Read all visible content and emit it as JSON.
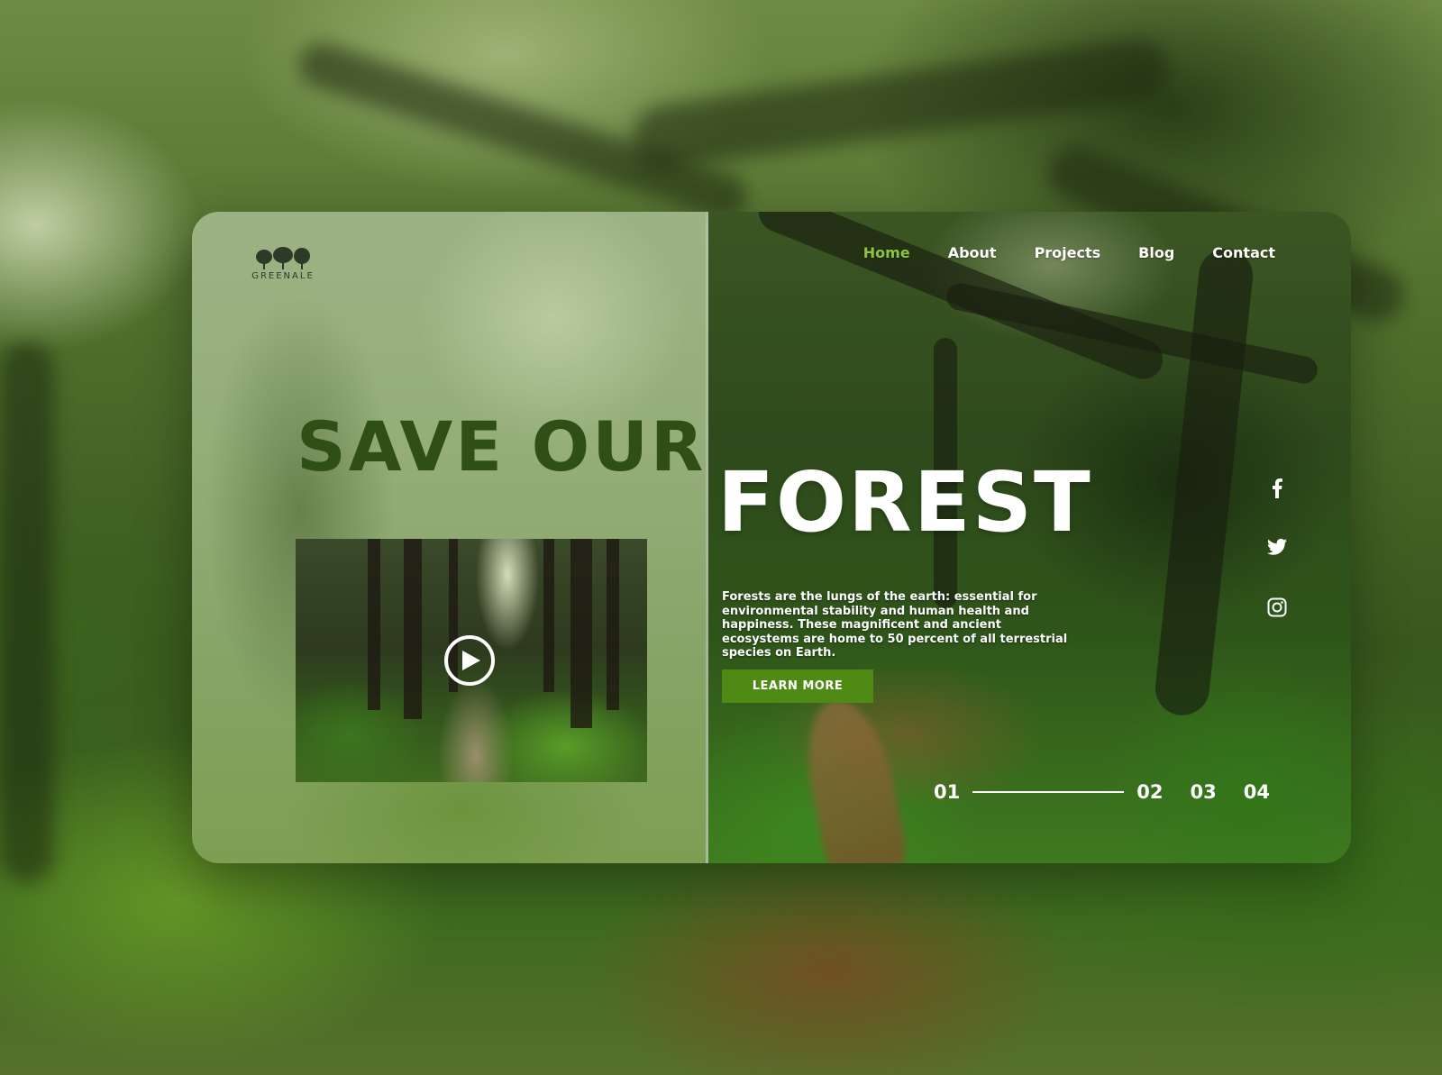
{
  "brand": {
    "logo_text": "GREENALE"
  },
  "nav": {
    "items": [
      "Home",
      "About",
      "Projects",
      "Blog",
      "Contact"
    ],
    "active": "Home",
    "active_color": "#8cc63f"
  },
  "hero": {
    "headline_part1": "SAVE OUR",
    "headline_part2": "FOREST",
    "description": "Forests are the lungs of the earth: essential for environmental stability and human health and happiness. These magnificent and ancient ecosystems are home to 50 percent of all terrestrial species on Earth.",
    "cta_label": "LEARN MORE",
    "cta_color": "#4e8a14"
  },
  "video": {
    "play_icon": "play-icon"
  },
  "social": [
    "facebook-icon",
    "twitter-icon",
    "instagram-icon"
  ],
  "pagination": {
    "pages": [
      "01",
      "02",
      "03",
      "04"
    ],
    "current": "01"
  }
}
